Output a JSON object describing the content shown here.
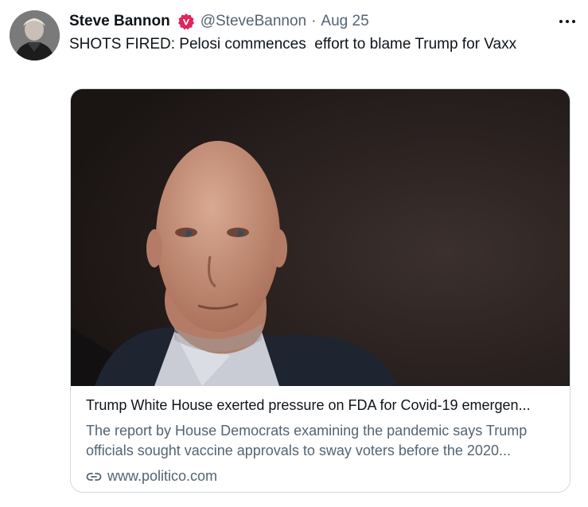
{
  "tweet": {
    "author_name": "Steve Bannon",
    "handle": "@SteveBannon",
    "separator": "·",
    "date": "Aug 25",
    "text": "SHOTS FIRED: Pelosi commences  effort to blame Trump for Vaxx",
    "verified_badge_color": "#e0245e",
    "avatar_icon": "profile-photo",
    "more_icon": "more-horizontal-icon"
  },
  "card": {
    "image_icon": "article-photo",
    "title": "Trump White House exerted pressure on FDA for Covid-19 emergen...",
    "description_line1": "The report by House Democrats examining the pandemic says Trump",
    "description_line2": "officials sought vaccine approvals to sway voters before the 2020...",
    "domain": "www.politico.com",
    "domain_icon": "link-icon"
  },
  "colors": {
    "text_primary": "#0f1419",
    "text_secondary": "#536471",
    "border": "#cfd9de"
  }
}
